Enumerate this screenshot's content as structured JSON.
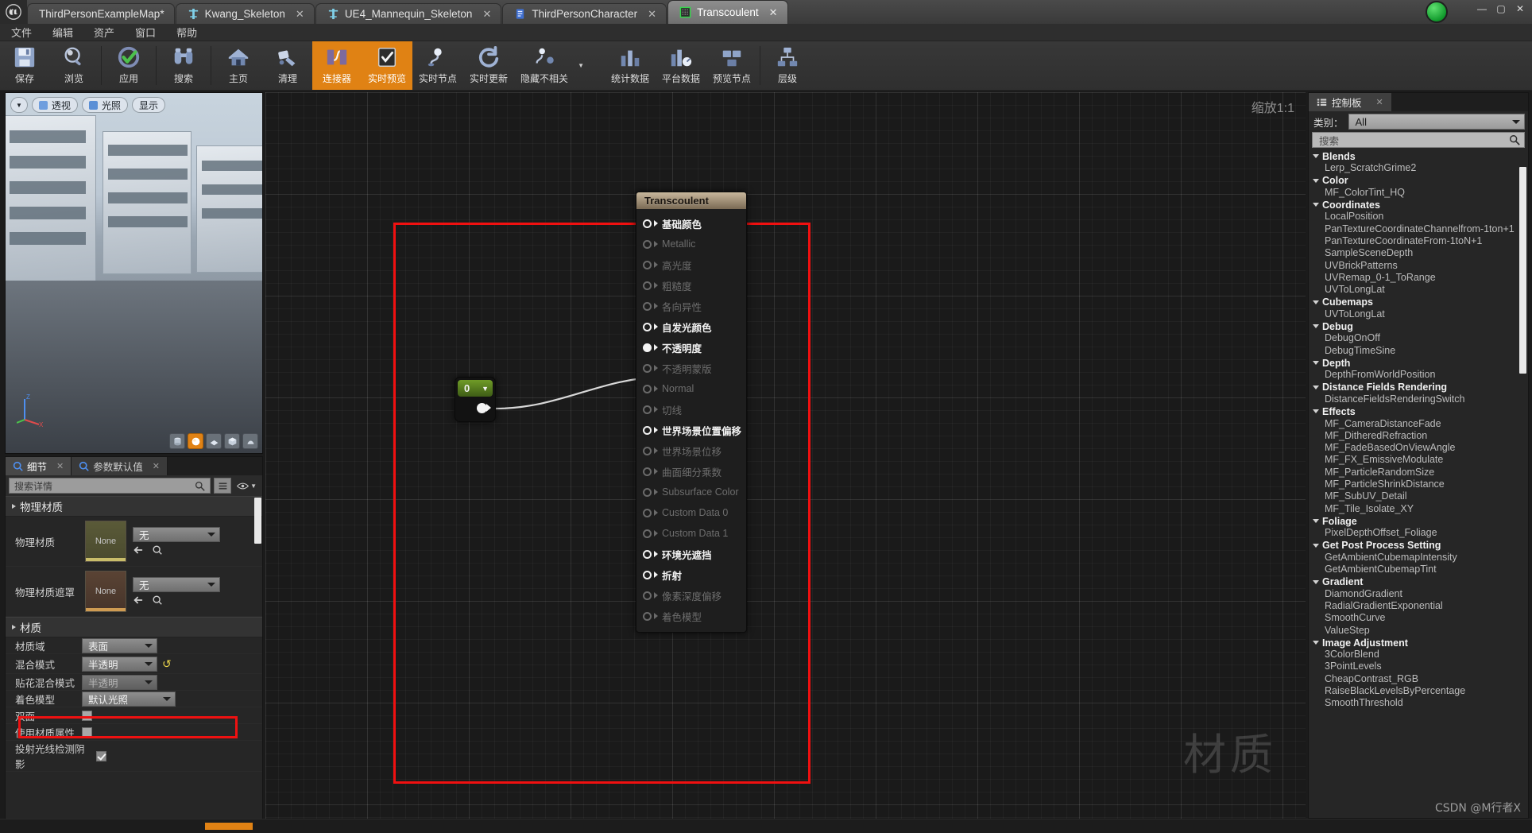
{
  "window": {
    "tabs": [
      {
        "label": "ThirdPersonExampleMap*",
        "icon": "map-icon",
        "active": false,
        "closable": false
      },
      {
        "label": "Kwang_Skeleton",
        "icon": "skeleton-icon",
        "active": false,
        "closable": true
      },
      {
        "label": "UE4_Mannequin_Skeleton",
        "icon": "skeleton-icon",
        "active": false,
        "closable": true
      },
      {
        "label": "ThirdPersonCharacter",
        "icon": "blueprint-icon",
        "active": false,
        "closable": true
      },
      {
        "label": "Transcoulent",
        "icon": "material-icon",
        "active": true,
        "closable": true
      }
    ],
    "controls": {
      "minimize": "—",
      "maximize": "▢",
      "close": "✕"
    }
  },
  "menubar": {
    "items": [
      "文件",
      "编辑",
      "资产",
      "窗口",
      "帮助"
    ]
  },
  "toolbar": {
    "items": [
      {
        "label": "保存",
        "icon": "save-icon",
        "active": false,
        "sep_after": false
      },
      {
        "label": "浏览",
        "icon": "browse-icon",
        "active": false,
        "sep_after": true
      },
      {
        "label": "应用",
        "icon": "apply-check-icon",
        "active": false,
        "sep_after": true
      },
      {
        "label": "搜索",
        "icon": "search-binoculars-icon",
        "active": false,
        "sep_after": true
      },
      {
        "label": "主页",
        "icon": "home-icon",
        "active": false,
        "sep_after": false
      },
      {
        "label": "清理",
        "icon": "clean-icon",
        "active": false,
        "sep_after": false
      },
      {
        "label": "连接器",
        "icon": "connectors-icon",
        "active": true,
        "sep_after": false
      },
      {
        "label": "实时预览",
        "icon": "live-preview-icon",
        "active": true,
        "sep_after": false
      },
      {
        "label": "实时节点",
        "icon": "live-nodes-icon",
        "active": false,
        "sep_after": false
      },
      {
        "label": "实时更新",
        "icon": "live-update-icon",
        "active": false,
        "sep_after": false
      },
      {
        "label": "隐藏不相关",
        "icon": "hide-unrelated-icon",
        "active": false,
        "sep_after": false,
        "has_caret": true
      },
      {
        "label": "统计数据",
        "icon": "stats-icon",
        "active": false,
        "sep_after": false,
        "gap_before": true
      },
      {
        "label": "平台数据",
        "icon": "platform-stats-icon",
        "active": false,
        "sep_after": false
      },
      {
        "label": "预览节点",
        "icon": "preview-node-icon",
        "active": false,
        "sep_after": true
      },
      {
        "label": "层级",
        "icon": "hierarchy-icon",
        "active": false,
        "sep_after": false
      }
    ]
  },
  "viewport": {
    "buttons": [
      {
        "label": "透视",
        "icon": "perspective-icon"
      },
      {
        "label": "光照",
        "icon": "lit-icon"
      },
      {
        "label": "显示",
        "icon": "show-icon"
      }
    ],
    "menu_caret": "▼",
    "shape_buttons": [
      "cylinder-preview-icon",
      "sphere-preview-icon",
      "plane-preview-icon",
      "cube-preview-icon",
      "custom-mesh-icon"
    ],
    "selected_shape_index": 1,
    "axis_labels": {
      "z": "Z",
      "x": "X",
      "y": "Y"
    }
  },
  "details": {
    "tabs": [
      {
        "label": "细节",
        "icon": "details-magnifier-icon",
        "active": true
      },
      {
        "label": "参数默认值",
        "icon": "params-magnifier-icon",
        "active": false
      }
    ],
    "search_placeholder": "搜索详情",
    "sections": [
      {
        "title": "物理材质",
        "asset_rows": [
          {
            "label": "物理材质",
            "thumb_text": "None",
            "value": "无",
            "thumb_style": "a"
          },
          {
            "label": "物理材质遮罩",
            "thumb_text": "None",
            "value": "无",
            "thumb_style": "b"
          }
        ]
      },
      {
        "title": "材质",
        "rows": [
          {
            "label": "材质域",
            "type": "combo",
            "value": "表面",
            "dim": false,
            "highlight": false
          },
          {
            "label": "混合模式",
            "type": "combo",
            "value": "半透明",
            "dim": false,
            "highlight": true,
            "reset": true
          },
          {
            "label": "贴花混合模式",
            "type": "combo",
            "value": "半透明",
            "dim": true,
            "highlight": false
          },
          {
            "label": "着色模型",
            "type": "combo",
            "value": "默认光照",
            "dim": false,
            "highlight": false
          },
          {
            "label": "双面",
            "type": "check",
            "checked": false
          },
          {
            "label": "使用材质属性",
            "type": "check",
            "checked": false
          },
          {
            "label": "投射光线检测阴影",
            "type": "check",
            "checked": true
          }
        ]
      }
    ]
  },
  "graph": {
    "zoom_label": "缩放1:1",
    "watermark": "材质",
    "material_node": {
      "title": "Transcoulent",
      "pins": [
        {
          "label": "基础颜色",
          "state": "active"
        },
        {
          "label": "Metallic",
          "state": "off"
        },
        {
          "label": "高光度",
          "state": "off"
        },
        {
          "label": "粗糙度",
          "state": "off"
        },
        {
          "label": "各向异性",
          "state": "off"
        },
        {
          "label": "自发光颜色",
          "state": "active"
        },
        {
          "label": "不透明度",
          "state": "filled"
        },
        {
          "label": "不透明蒙版",
          "state": "off"
        },
        {
          "label": "Normal",
          "state": "off"
        },
        {
          "label": "切线",
          "state": "off"
        },
        {
          "label": "世界场景位置偏移",
          "state": "active"
        },
        {
          "label": "世界场景位移",
          "state": "off"
        },
        {
          "label": "曲面细分乘数",
          "state": "off"
        },
        {
          "label": "Subsurface Color",
          "state": "off"
        },
        {
          "label": "Custom Data 0",
          "state": "off"
        },
        {
          "label": "Custom Data 1",
          "state": "off"
        },
        {
          "label": "环境光遮挡",
          "state": "active"
        },
        {
          "label": "折射",
          "state": "active"
        },
        {
          "label": "像素深度偏移",
          "state": "off"
        },
        {
          "label": "着色模型",
          "state": "off"
        }
      ]
    },
    "const_node": {
      "value": "0",
      "caret": "▼"
    }
  },
  "palette": {
    "tab_label": "控制板",
    "category_label": "类别：",
    "category_value": "All",
    "search_placeholder": "搜索",
    "entries": [
      {
        "type": "group",
        "label": "Blends"
      },
      {
        "type": "item",
        "label": "Lerp_ScratchGrime2"
      },
      {
        "type": "group",
        "label": "Color"
      },
      {
        "type": "item",
        "label": "MF_ColorTint_HQ"
      },
      {
        "type": "group",
        "label": "Coordinates"
      },
      {
        "type": "item",
        "label": "LocalPosition"
      },
      {
        "type": "item",
        "label": "PanTextureCoordinateChannelfrom-1ton+1"
      },
      {
        "type": "item",
        "label": "PanTextureCoordinateFrom-1toN+1"
      },
      {
        "type": "item",
        "label": "SampleSceneDepth"
      },
      {
        "type": "item",
        "label": "UVBrickPatterns"
      },
      {
        "type": "item",
        "label": "UVRemap_0-1_ToRange"
      },
      {
        "type": "item",
        "label": "UVToLongLat"
      },
      {
        "type": "group",
        "label": "Cubemaps"
      },
      {
        "type": "item",
        "label": "UVToLongLat"
      },
      {
        "type": "group",
        "label": "Debug"
      },
      {
        "type": "item",
        "label": "DebugOnOff"
      },
      {
        "type": "item",
        "label": "DebugTimeSine"
      },
      {
        "type": "group",
        "label": "Depth"
      },
      {
        "type": "item",
        "label": "DepthFromWorldPosition"
      },
      {
        "type": "group",
        "label": "Distance Fields Rendering"
      },
      {
        "type": "item",
        "label": "DistanceFieldsRenderingSwitch"
      },
      {
        "type": "group",
        "label": "Effects"
      },
      {
        "type": "item",
        "label": "MF_CameraDistanceFade"
      },
      {
        "type": "item",
        "label": "MF_DitheredRefraction"
      },
      {
        "type": "item",
        "label": "MF_FadeBasedOnViewAngle"
      },
      {
        "type": "item",
        "label": "MF_FX_EmissiveModulate"
      },
      {
        "type": "item",
        "label": "MF_ParticleRandomSize"
      },
      {
        "type": "item",
        "label": "MF_ParticleShrinkDistance"
      },
      {
        "type": "item",
        "label": "MF_SubUV_Detail"
      },
      {
        "type": "item",
        "label": "MF_Tile_Isolate_XY"
      },
      {
        "type": "group",
        "label": "Foliage"
      },
      {
        "type": "item",
        "label": "PixelDepthOffset_Foliage"
      },
      {
        "type": "group",
        "label": "Get Post Process Setting"
      },
      {
        "type": "item",
        "label": "GetAmbientCubemapIntensity"
      },
      {
        "type": "item",
        "label": "GetAmbientCubemapTint"
      },
      {
        "type": "group",
        "label": "Gradient"
      },
      {
        "type": "item",
        "label": "DiamondGradient"
      },
      {
        "type": "item",
        "label": "RadialGradientExponential"
      },
      {
        "type": "item",
        "label": "SmoothCurve"
      },
      {
        "type": "item",
        "label": "ValueStep"
      },
      {
        "type": "group",
        "label": "Image Adjustment"
      },
      {
        "type": "item",
        "label": "3ColorBlend"
      },
      {
        "type": "item",
        "label": "3PointLevels"
      },
      {
        "type": "item",
        "label": "CheapContrast_RGB"
      },
      {
        "type": "item",
        "label": "RaiseBlackLevelsByPercentage"
      },
      {
        "type": "item",
        "label": "SmoothThreshold"
      }
    ]
  },
  "watermark_credit": "CSDN @M行者X",
  "colors": {
    "accent": "#e08214",
    "highlight": "#ee1111",
    "node_green": "#6f9b27",
    "node_title": "#c8b79c"
  }
}
